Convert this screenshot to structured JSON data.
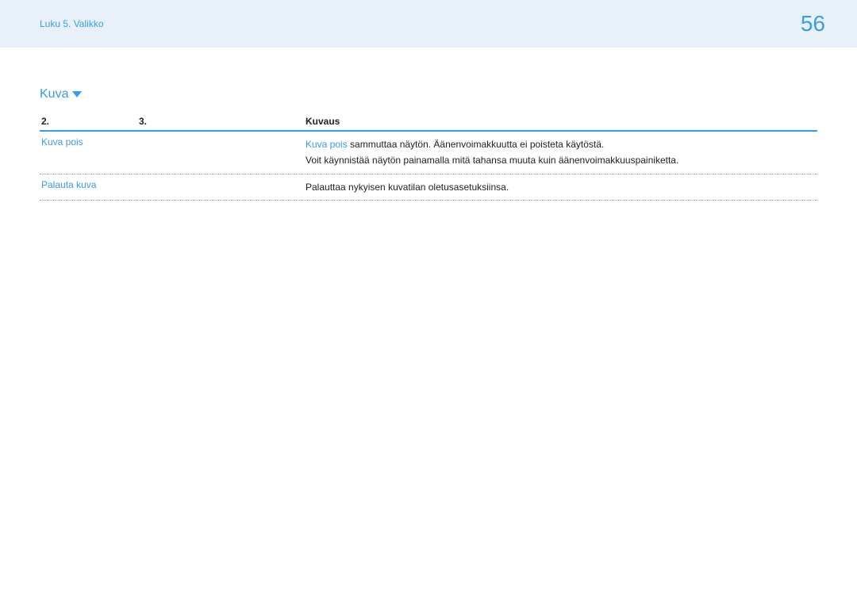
{
  "header": {
    "breadcrumb": "Luku 5. Valikko",
    "page_number": "56"
  },
  "section": {
    "title": "Kuva"
  },
  "table": {
    "headers": {
      "col2": "2.",
      "col3": "3.",
      "desc": "Kuvaus"
    },
    "rows": [
      {
        "label": "Kuva pois",
        "desc_accent": "Kuva pois",
        "desc_line1_rest": " sammuttaa näytön. Äänenvoimakkuutta ei poisteta käytöstä.",
        "desc_line2": "Voit käynnistää näytön painamalla mitä tahansa muuta kuin äänenvoimakkuuspainiketta."
      },
      {
        "label": "Palauta kuva",
        "desc": "Palauttaa nykyisen kuvatilan oletusasetuksiinsa."
      }
    ]
  }
}
